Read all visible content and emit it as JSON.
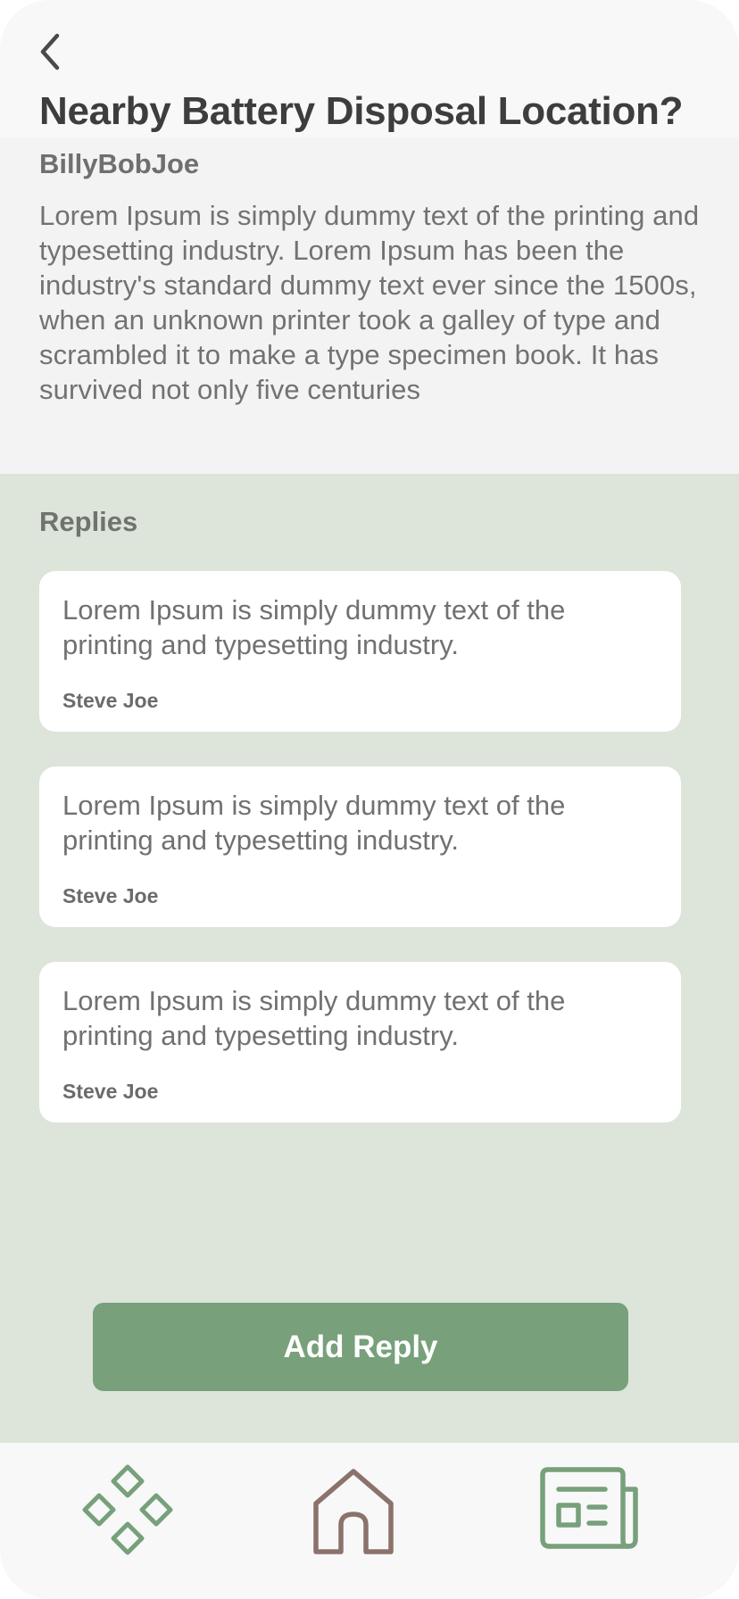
{
  "header": {
    "back_icon": "chevron-left-icon",
    "title": "Nearby Battery Disposal Location?"
  },
  "post": {
    "author": "BillyBobJoe",
    "body": "Lorem Ipsum is simply dummy text of the printing and typesetting industry. Lorem Ipsum has been the industry's standard dummy text ever since the 1500s, when an unknown printer took a galley of type and scrambled it to make a type specimen book. It has survived not only five centuries"
  },
  "replies": {
    "heading": "Replies",
    "items": [
      {
        "text": "Lorem Ipsum is simply dummy text of the printing and typesetting industry.",
        "author": "Steve Joe"
      },
      {
        "text": "Lorem Ipsum is simply dummy text of the printing and typesetting industry.",
        "author": "Steve Joe"
      },
      {
        "text": "Lorem Ipsum is simply dummy text of the printing and typesetting industry.",
        "author": "Steve Joe"
      }
    ],
    "add_reply_label": "Add Reply"
  },
  "bottom_nav": {
    "items": [
      {
        "icon": "diamonds-icon",
        "color": "#77a07b"
      },
      {
        "icon": "home-icon",
        "color": "#8b726b"
      },
      {
        "icon": "newspaper-icon",
        "color": "#77a07b"
      }
    ]
  },
  "colors": {
    "accent": "#77a07b",
    "replies_background": "#dde4da",
    "home_icon": "#8b726b"
  }
}
